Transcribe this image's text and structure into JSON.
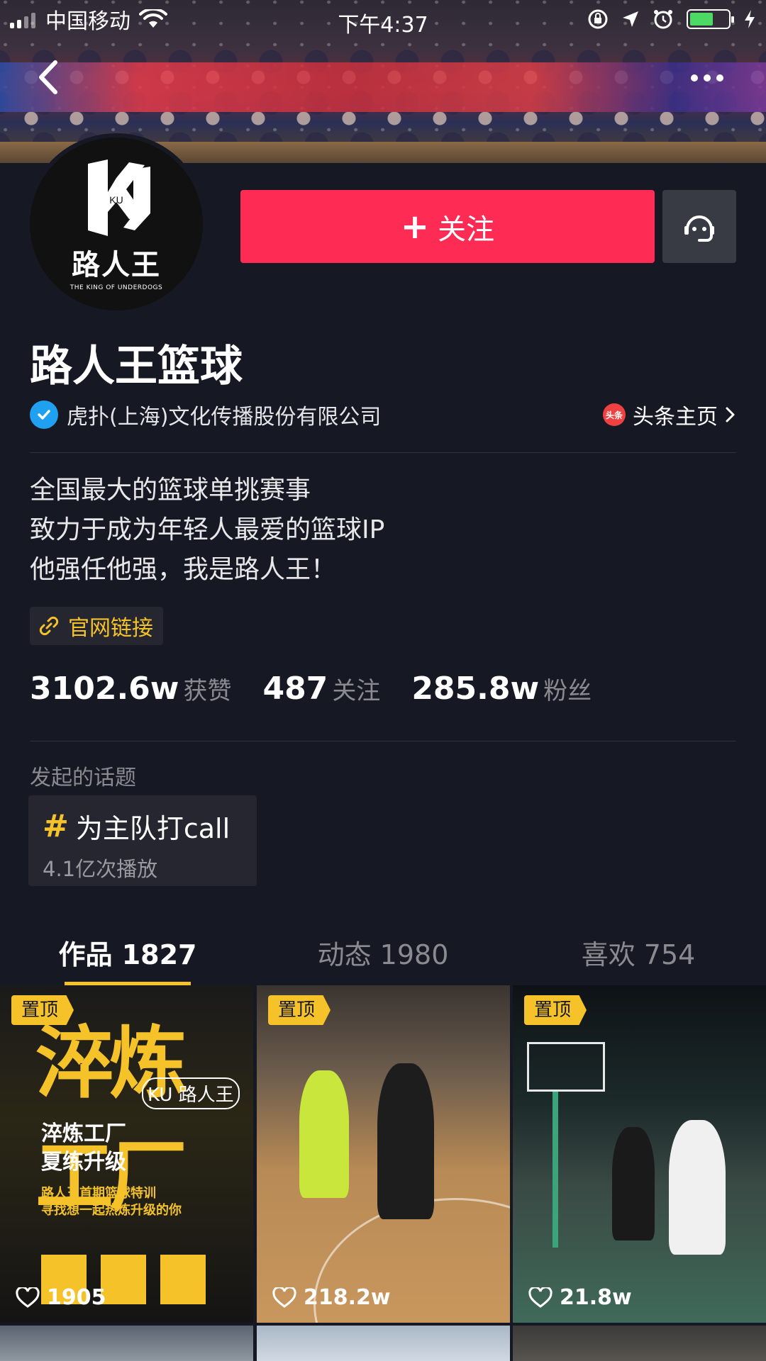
{
  "status_bar": {
    "carrier": "中国移动",
    "time": "下午4:37"
  },
  "avatar": {
    "logo_letters": "KU",
    "logo_cn": "路人王",
    "logo_en": "THE KING OF UNDERDOGS"
  },
  "actions": {
    "follow_label": "关注"
  },
  "profile": {
    "name": "路人王篮球",
    "verification": "虎扑(上海)文化传播股份有限公司",
    "toutiao_badge": "头条",
    "toutiao_link": "头条主页",
    "bio": [
      "全国最大的篮球单挑赛事",
      "致力于成为年轻人最爱的篮球IP",
      "他强任他强，我是路人王！"
    ],
    "website_link": "官网链接"
  },
  "stats": [
    {
      "value": "3102.6w",
      "label": "获赞"
    },
    {
      "value": "487",
      "label": "关注"
    },
    {
      "value": "285.8w",
      "label": "粉丝"
    }
  ],
  "topics": {
    "title": "发起的话题",
    "items": [
      {
        "name": "为主队打call",
        "plays": "4.1亿次播放"
      }
    ]
  },
  "tabs": [
    {
      "label": "作品 1827",
      "active": true
    },
    {
      "label": "动态 1980",
      "active": false
    },
    {
      "label": "喜欢 754",
      "active": false
    }
  ],
  "videos": [
    {
      "pinned_label": "置顶",
      "likes": "1905",
      "poster_title": "淬炼工厂",
      "poster_logo": "KU 路人王",
      "poster_subtitle": [
        "淬炼工厂",
        "夏练升级"
      ],
      "poster_caption": [
        "路人王首期篮球特训",
        "寻找想一起热炼升级的你"
      ]
    },
    {
      "pinned_label": "置顶",
      "likes": "218.2w"
    },
    {
      "pinned_label": "置顶",
      "likes": "21.8w"
    }
  ],
  "colors": {
    "background": "#161823",
    "accent_red": "#fe2c55",
    "accent_yellow": "#f5c22a",
    "verified_blue": "#20a0f0"
  }
}
